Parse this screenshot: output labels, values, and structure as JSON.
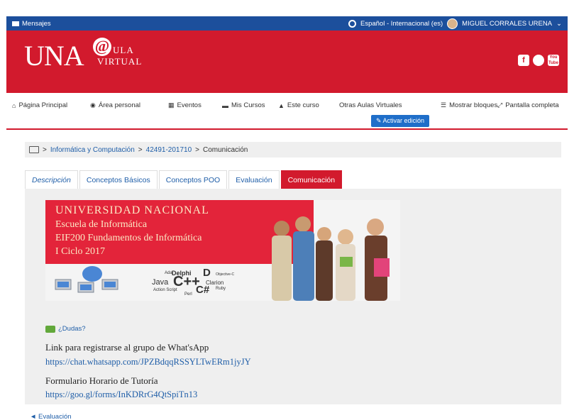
{
  "topbar": {
    "messages": "Mensajes",
    "language": "Español - Internacional (es)",
    "user": "MIGUEL CORRALES URENA",
    "user_caret": "⌄"
  },
  "banner": {
    "logo_una": "UNA",
    "logo_at": "@",
    "logo_ula": "ULA",
    "logo_virtual": "VIRTUAL",
    "social": [
      "f",
      "",
      "You Tube"
    ]
  },
  "nav": {
    "home": "Página Principal",
    "personal": "Área personal",
    "events": "Eventos",
    "my_courses": "Mis Cursos",
    "this_course": "Este curso",
    "other": "Otras Aulas Virtuales",
    "show_blocks": "Mostrar bloques",
    "fullscreen": "Pantalla completa",
    "edit": "Activar edición"
  },
  "breadcrumb": {
    "sep": ">",
    "items": [
      "Informática y Computación",
      "42491-201710",
      "Comunicación"
    ]
  },
  "tabs": [
    "Descripción",
    "Conceptos Básicos",
    "Conceptos POO",
    "Evaluación",
    "Comunicación"
  ],
  "hero": {
    "line1": "UNIVERSIDAD NACIONAL",
    "line2": "Escuela de Informática",
    "line3": "EIF200 Fundamentos de Informática",
    "line4": "I Ciclo 2017",
    "words": [
      "Delphi",
      "D",
      "Java",
      "C++",
      "Clarion",
      "C#",
      "Ada",
      "Perl",
      "Action Script",
      "Objective-C",
      "Ruby"
    ]
  },
  "content": {
    "dudas": "¿Dudas?",
    "whatsapp_label": "Link para registrarse al grupo de What'sApp",
    "whatsapp_link": "https://chat.whatsapp.com/JPZBdqqRSSYLTwERm1jyJY",
    "tutoria_label": "Formulario Horario de Tutoría",
    "tutoria_link": "https://goo.gl/forms/InKDRrG4QtSpiTn13"
  },
  "footer": {
    "prev": "◄ Evaluación"
  },
  "colors": {
    "topbar": "#1c4f9c",
    "brand_red": "#d21a2d",
    "link": "#1f5ea8",
    "edit_button": "#1f6ec9"
  }
}
